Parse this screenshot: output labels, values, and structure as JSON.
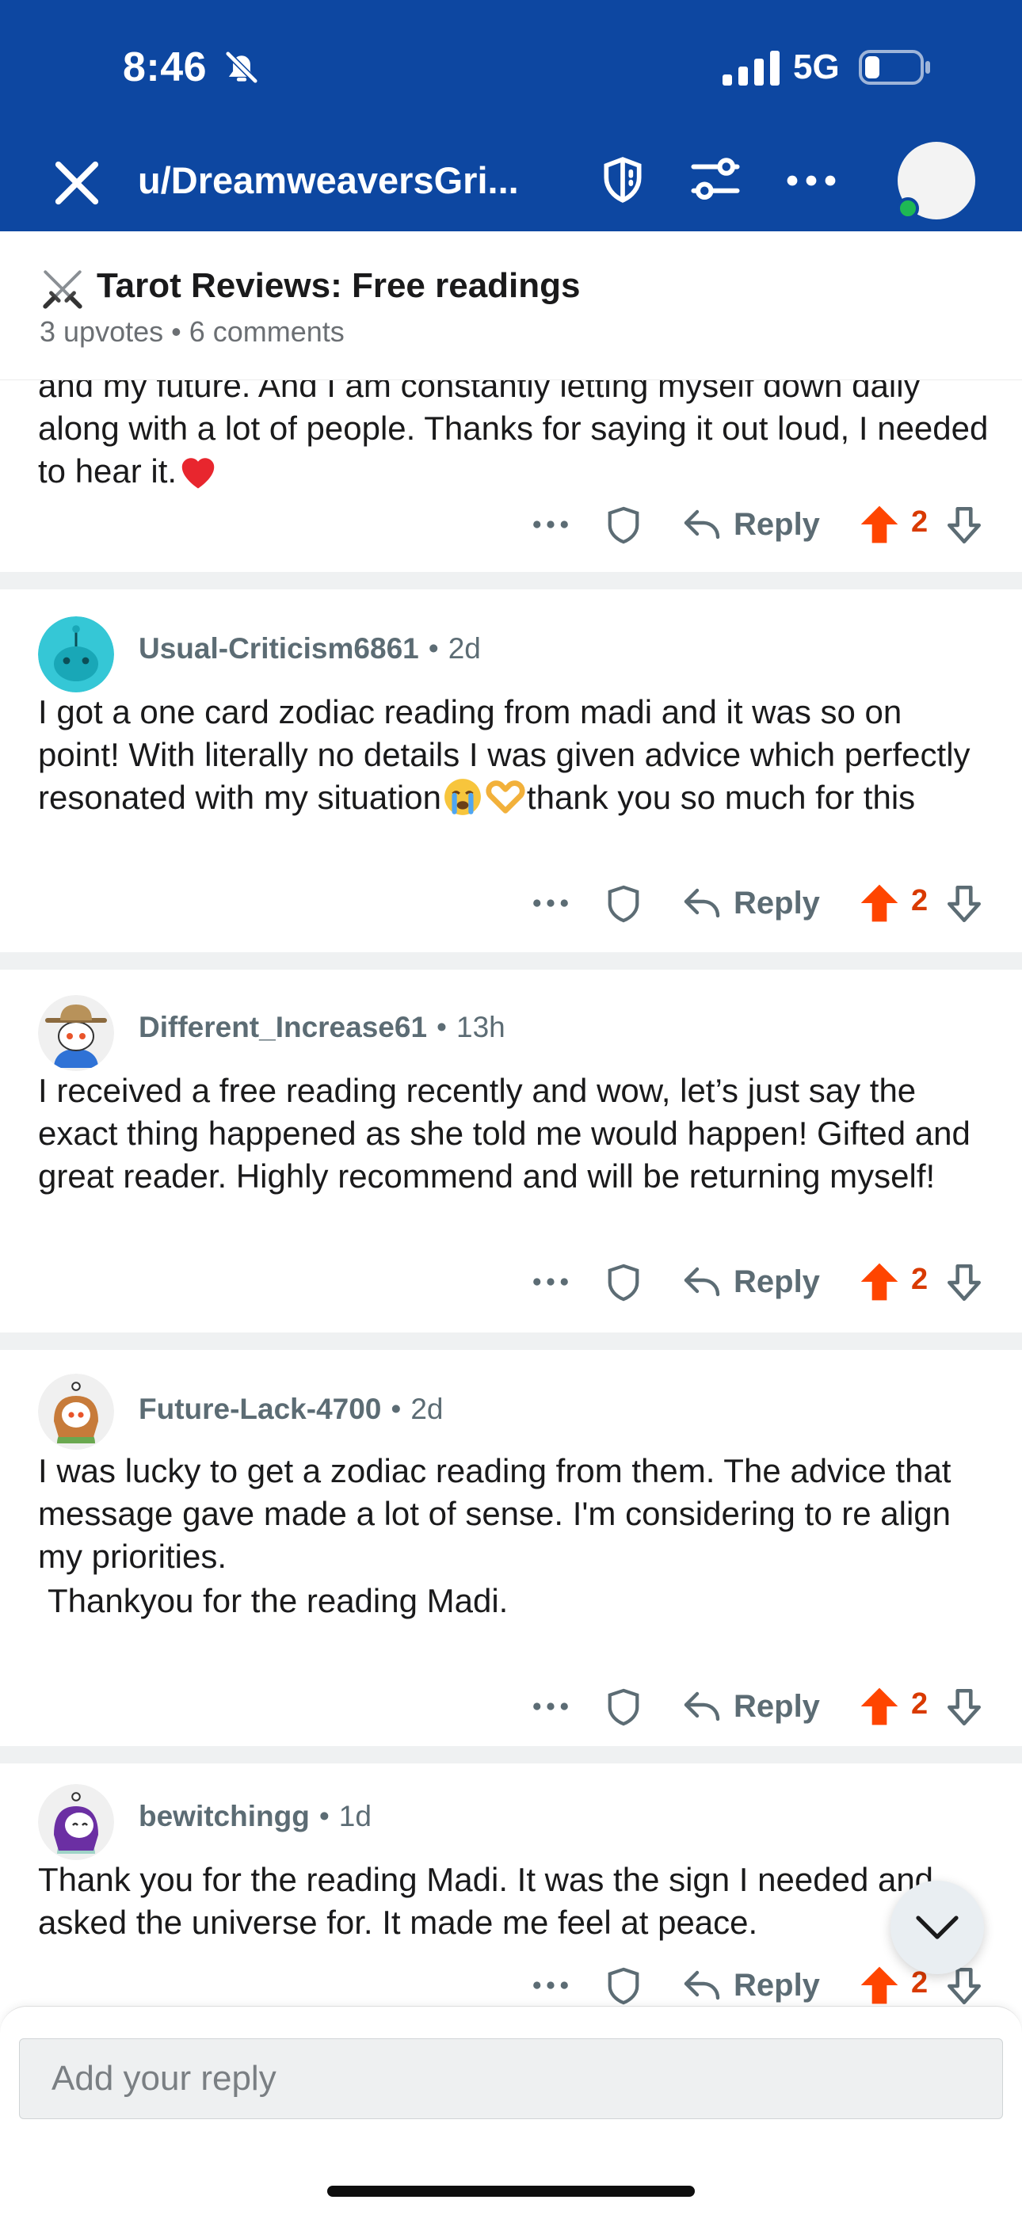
{
  "status_bar": {
    "time": "8:46",
    "network": "5G"
  },
  "nav": {
    "title": "u/DreamweaversGri..."
  },
  "post": {
    "title": "Tarot Reviews: Free readings",
    "meta": "3 upvotes • 6 comments"
  },
  "comments": [
    {
      "text_a": "and my future. And I am constantly letting myself down daily along with a lot of people. Thanks for saying it out loud, I needed to hear it.",
      "votes": "2",
      "reply_label": "Reply"
    },
    {
      "username": "Usual-Criticism6861",
      "age": "2d",
      "text_a": "I got a one card zodiac reading from madi and it was so on point! With literally no details I was given advice which perfectly resonated with my situation",
      "text_b": "thank you so much for this",
      "votes": "2",
      "reply_label": "Reply"
    },
    {
      "username": "Different_Increase61",
      "age": "13h",
      "text_a": "I received a free reading recently and wow, let’s just say the exact thing happened as she told me would happen! Gifted and great reader. Highly recommend and will be returning myself!",
      "votes": "2",
      "reply_label": "Reply"
    },
    {
      "username": "Future-Lack-4700",
      "age": "2d",
      "text_a": "I was lucky to get a zodiac reading from them. The advice that message gave made a lot of sense. I'm considering to re align my priorities.",
      "text_b": "Thankyou for the reading Madi.",
      "votes": "2",
      "reply_label": "Reply"
    },
    {
      "username": "bewitchingg",
      "age": "1d",
      "text_a": "Thank you for the reading Madi. It was the sign I needed and asked the universe for. It made me feel at peace.",
      "votes": "2",
      "reply_label": "Reply"
    }
  ],
  "composer": {
    "placeholder": "Add your reply"
  },
  "colors": {
    "header_bg": "#0d47a1",
    "upvote": "#ff4500",
    "vote_count": "#d93a00",
    "meta_gray": "#5c6c74",
    "separator": "#eff1f2",
    "online": "#1eb854"
  },
  "icons": [
    "bell-muted-icon",
    "signal-icon",
    "battery-icon",
    "close-icon",
    "mod-shield-icon",
    "filter-icon",
    "more-icon",
    "crossed-swords-icon",
    "red-heart-icon",
    "crying-face-icon",
    "heart-hands-icon",
    "award-icon",
    "reply-icon",
    "upvote-icon",
    "downvote-icon",
    "chevron-down-icon"
  ]
}
